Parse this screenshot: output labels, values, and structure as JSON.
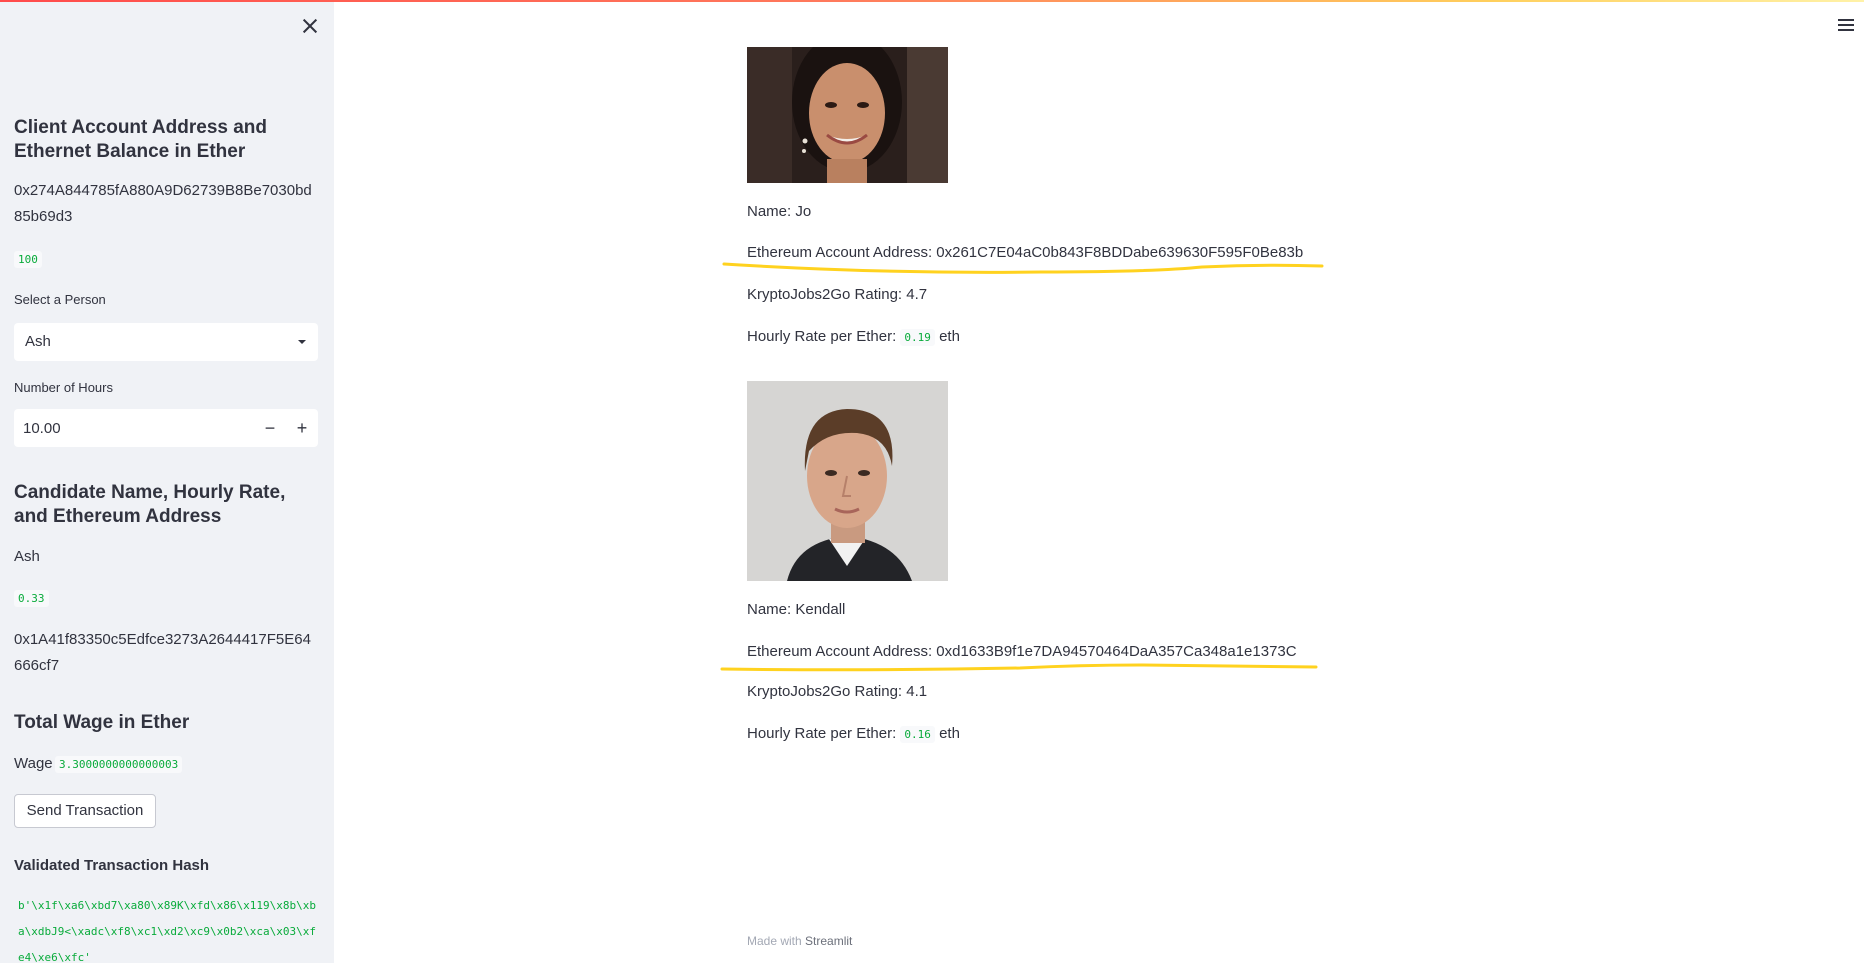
{
  "sidebar": {
    "account_heading": "Client Account Address and Ethernet Balance in Ether",
    "account_address": "0x274A844785fA880A9D62739B8Be7030bd85b69d3",
    "balance": "100",
    "select_label": "Select a Person",
    "select_value": "Ash",
    "hours_label": "Number of Hours",
    "hours_value": "10.00",
    "candidate_heading": "Candidate Name, Hourly Rate, and Ethereum Address",
    "candidate_name": "Ash",
    "candidate_rate": "0.33",
    "candidate_address": "0x1A41f83350c5Edfce3273A2644417F5E64666cf7",
    "wage_heading": "Total Wage in Ether",
    "wage_label": "Wage",
    "wage_value": "3.3000000000000003",
    "send_button": "Send Transaction",
    "hash_heading": "Validated Transaction Hash",
    "hash_value": "b'\\x1f\\xa6\\xbd7\\xa80\\x89K\\xfd\\x86\\x119\\x8b\\xba\\xdbJ9<\\xadc\\xf8\\xc1\\xd2\\xc9\\x0b2\\xca\\x03\\xfe4\\xe6\\xfc'"
  },
  "candidates": [
    {
      "name_text": "Name: Jo",
      "address_text": "Ethereum Account Address: 0x261C7E04aC0b843F8BDDabe639630F595F0Be83b",
      "rating_text": "KryptoJobs2Go Rating: 4.7",
      "rate_label": "Hourly Rate per Ether:",
      "rate_value": "0.19",
      "rate_unit": "eth"
    },
    {
      "name_text": "Name: Kendall",
      "address_text": "Ethereum Account Address: 0xd1633B9f1e7DA94570464DaA357Ca348a1e1373C",
      "rating_text": "KryptoJobs2Go Rating: 4.1",
      "rate_label": "Hourly Rate per Ether:",
      "rate_value": "0.16",
      "rate_unit": "eth"
    }
  ],
  "footer": {
    "prefix": "Made with",
    "brand": "Streamlit"
  },
  "colors": {
    "highlight": "#ffd21f",
    "code_green": "#09ab3b",
    "sidebar_bg": "#f0f2f6"
  },
  "icons": [
    "close-icon",
    "hamburger-menu-icon",
    "chevron-down-icon",
    "minus-icon",
    "plus-icon"
  ]
}
